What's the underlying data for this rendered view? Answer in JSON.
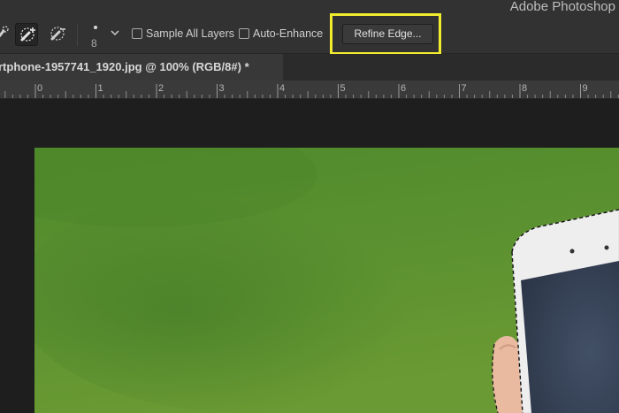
{
  "app": {
    "title": "Adobe Photoshop"
  },
  "options_bar": {
    "tools": [
      "quick-selection-tool",
      "add-to-selection-tool",
      "subtract-from-selection-tool"
    ],
    "brush_size": "8",
    "sample_all_layers_label": "Sample All Layers",
    "sample_all_layers_checked": false,
    "auto_enhance_label": "Auto-Enhance",
    "auto_enhance_checked": false,
    "refine_edge_label": "Refine Edge...",
    "highlight_color": "#f2ec2f"
  },
  "document": {
    "tab_label": "rtphone-1957741_1920.jpg @ 100% (RGB/8#) *"
  },
  "ruler": {
    "labels": [
      "0",
      "1",
      "2",
      "3",
      "4",
      "5",
      "6",
      "7",
      "8",
      "9"
    ]
  },
  "colors": {
    "panel": "#323232",
    "canvas_bg": "#1e1e1e",
    "grass_green": "#5a8f2f"
  }
}
